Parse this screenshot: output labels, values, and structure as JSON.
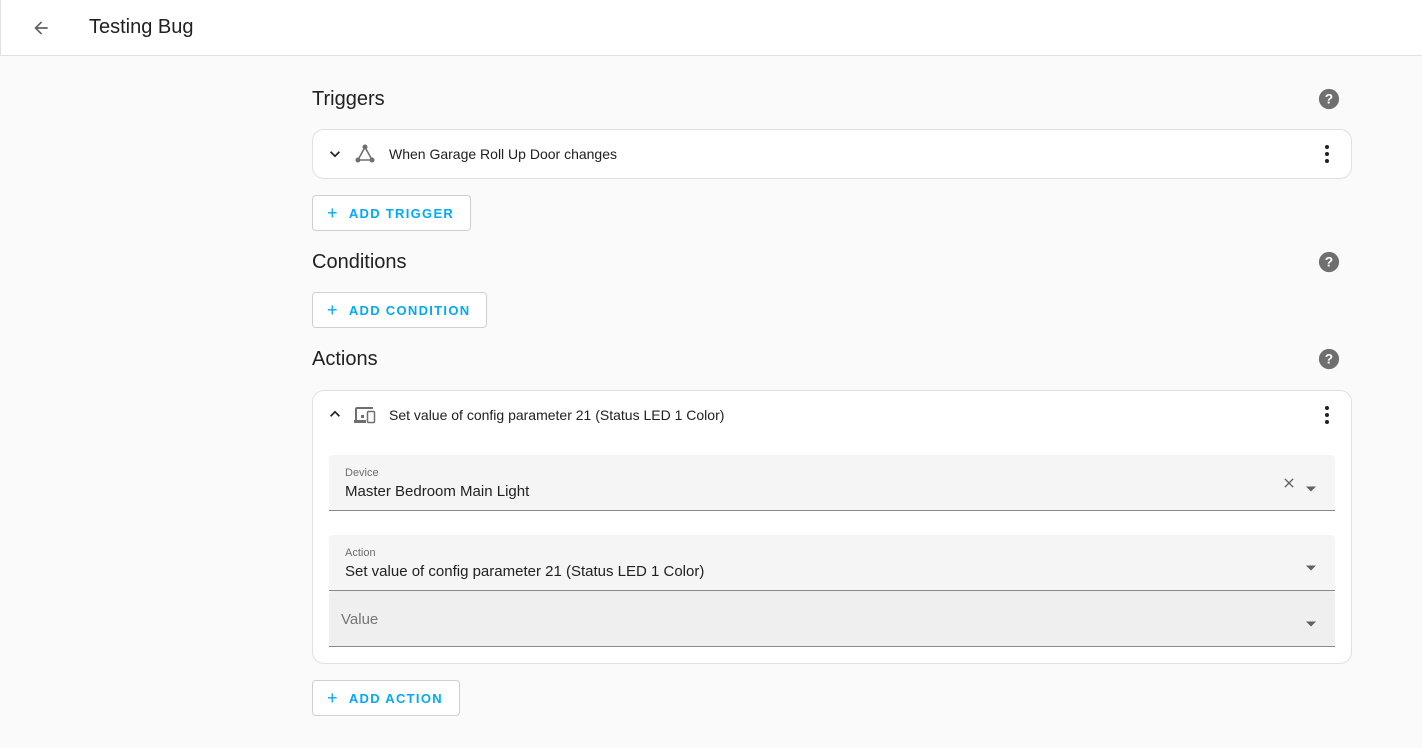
{
  "header": {
    "title": "Testing Bug"
  },
  "triggers": {
    "title": "Triggers",
    "items": [
      {
        "label": "When Garage Roll Up Door changes"
      }
    ],
    "add_label": "ADD TRIGGER"
  },
  "conditions": {
    "title": "Conditions",
    "add_label": "ADD CONDITION"
  },
  "actions": {
    "title": "Actions",
    "items": [
      {
        "label": "Set value of config parameter 21 (Status LED 1 Color)",
        "device_field": {
          "label": "Device",
          "value": "Master Bedroom Main Light"
        },
        "action_field": {
          "label": "Action",
          "value": "Set value of config parameter 21 (Status LED 1 Color)"
        },
        "value_field": {
          "placeholder": "Value"
        }
      }
    ],
    "add_label": "ADD ACTION"
  },
  "colors": {
    "accent": "#03a9f4",
    "icon": "#616161"
  },
  "icons": {
    "back": "arrow-left-icon",
    "help": "help-circle-icon",
    "trigger": "state-change-icon",
    "action": "device-icon",
    "more": "dots-vertical-icon"
  }
}
